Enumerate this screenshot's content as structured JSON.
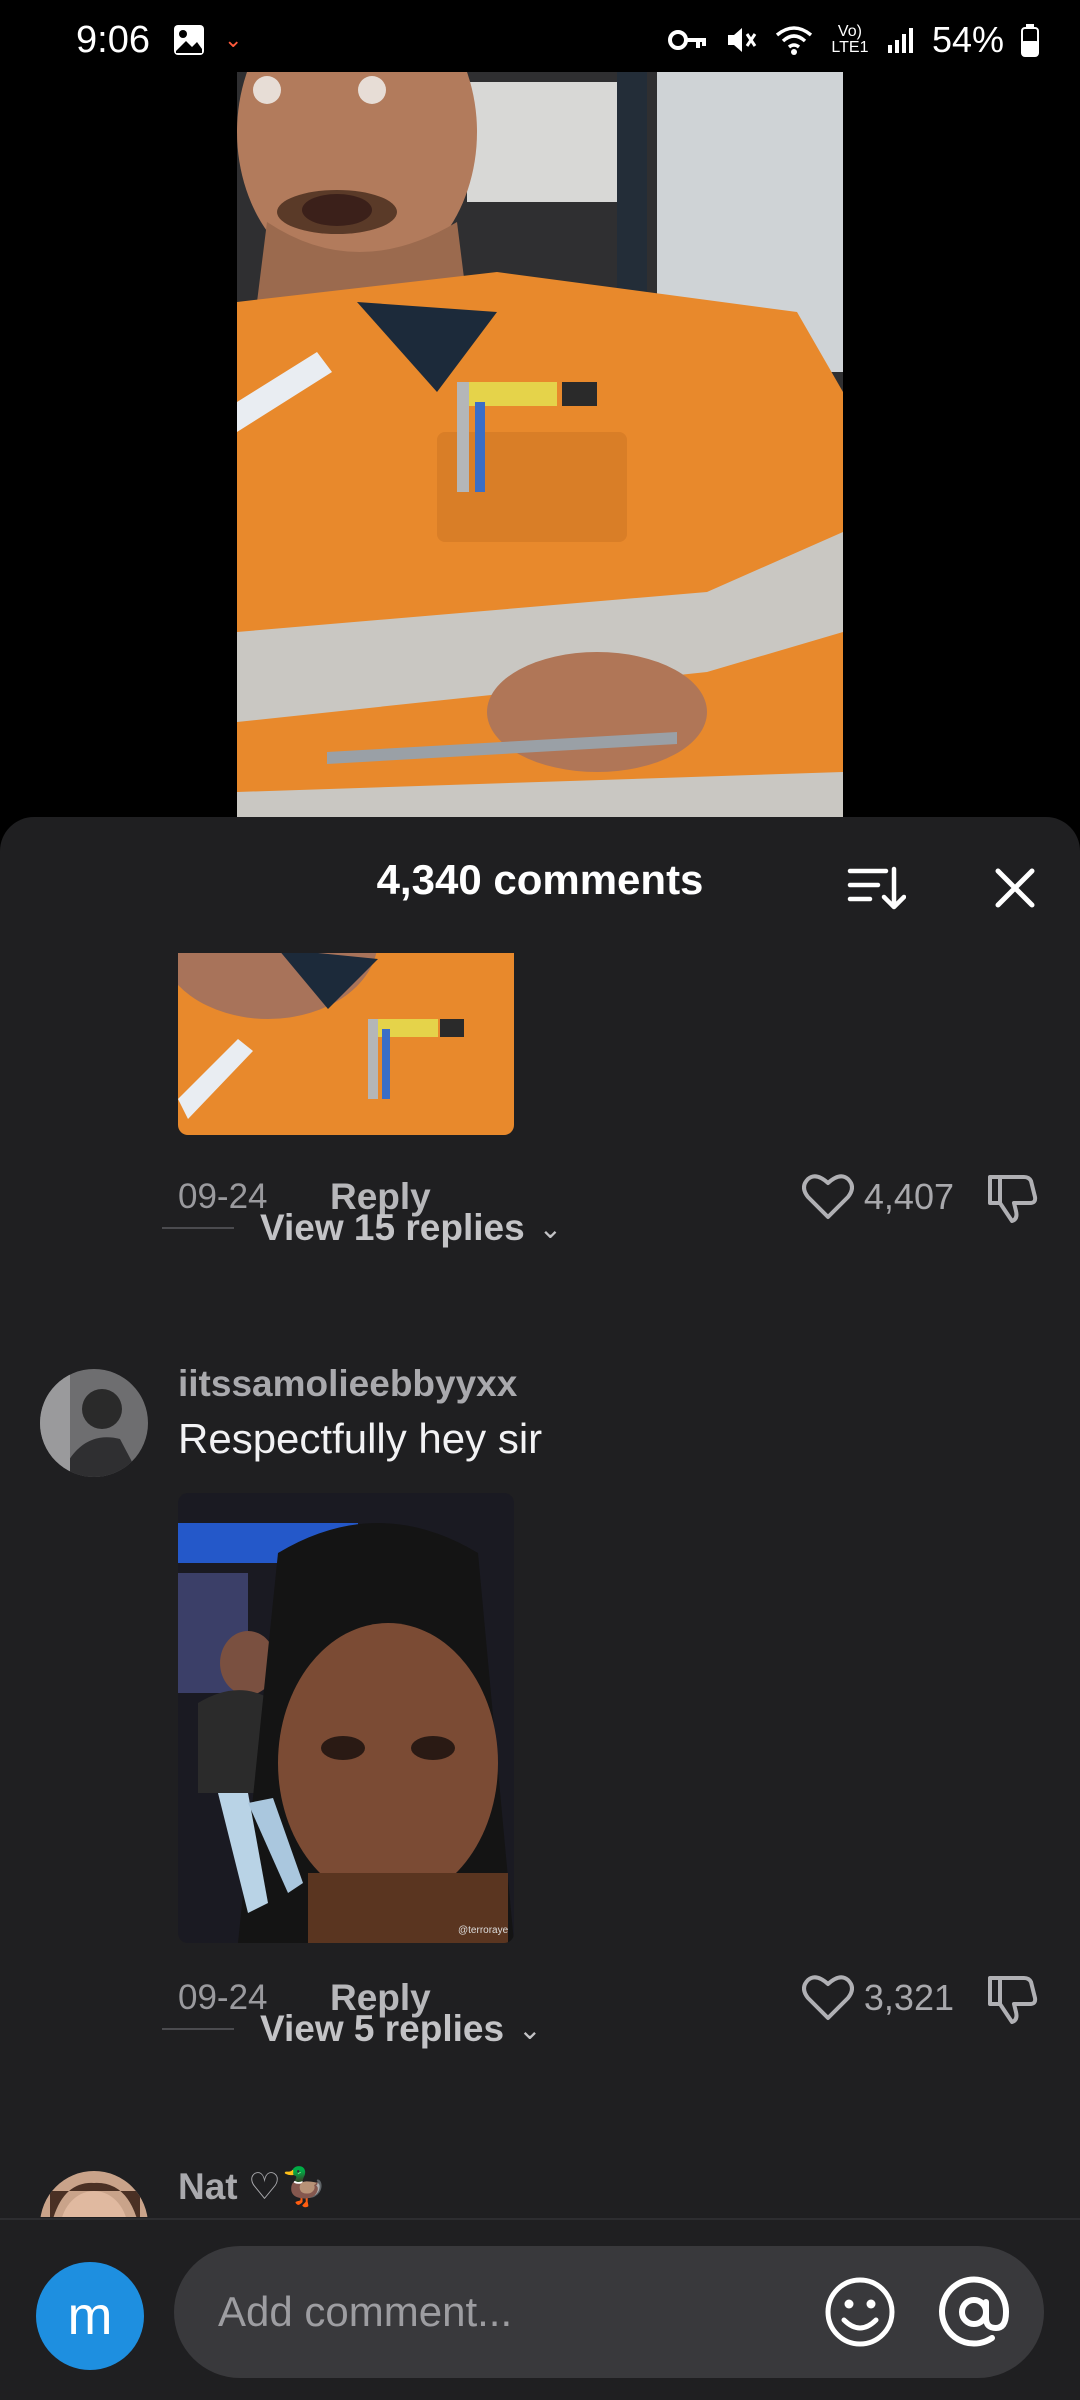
{
  "status_bar": {
    "time": "9:06",
    "battery": "54%",
    "network": "Vo) LTE1",
    "icons": [
      "gallery-icon",
      "key-icon",
      "mute-icon",
      "wifi-icon",
      "signal-icon",
      "battery-icon"
    ]
  },
  "sheet": {
    "title": "4,340 comments",
    "sort_icon": "sort-icon",
    "close_icon": "close-icon"
  },
  "comments": [
    {
      "date": "09-24",
      "reply_label": "Reply",
      "likes": "4,407",
      "view_replies": "View 15 replies"
    },
    {
      "username": "iitssamolieebbyyxx",
      "text": "Respectfully hey sir",
      "image_watermark": "@terroraye",
      "date": "09-24",
      "reply_label": "Reply",
      "likes": "3,321",
      "view_replies": "View 5 replies"
    },
    {
      "username": "Nat ♡🦆"
    }
  ],
  "composer": {
    "avatar_letter": "m",
    "placeholder": "Add comment..."
  },
  "colors": {
    "sheet_bg": "#1f1f21",
    "avatar_blue": "#1e8fe0",
    "shirt_orange": "#e8892c"
  }
}
